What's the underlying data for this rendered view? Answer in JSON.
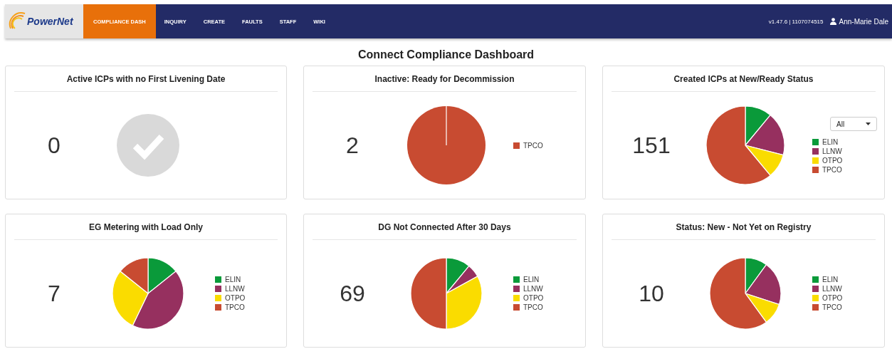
{
  "nav": {
    "logo": "PowerNet",
    "items": [
      {
        "label": "COMPLIANCE DASH",
        "selected": true
      },
      {
        "label": "INQUIRY",
        "selected": false
      },
      {
        "label": "CREATE",
        "selected": false
      },
      {
        "label": "FAULTS",
        "selected": false
      },
      {
        "label": "STAFF",
        "selected": false
      },
      {
        "label": "WIKI",
        "selected": false
      }
    ],
    "version": "v1.47.6 | 1107074515",
    "user": "Ann-Marie Dale"
  },
  "title": "Connect Compliance Dashboard",
  "cards": [
    {
      "title": "Active ICPs with no First Livening Date",
      "count": "0",
      "kind": "check"
    },
    {
      "title": "Inactive: Ready for Decommission",
      "count": "2",
      "kind": "pie",
      "legend": [
        {
          "label": "TPCO",
          "color": "#c84b31"
        }
      ]
    },
    {
      "title": "Created ICPs at New/Ready Status",
      "count": "151",
      "kind": "pie",
      "filter": "All",
      "legend": [
        {
          "label": "ELIN",
          "color": "#0a9a3a"
        },
        {
          "label": "LLNW",
          "color": "#96305f"
        },
        {
          "label": "OTPO",
          "color": "#fadc00"
        },
        {
          "label": "TPCO",
          "color": "#c84b31"
        }
      ]
    },
    {
      "title": "EG Metering with Load Only",
      "count": "7",
      "kind": "pie",
      "legend": [
        {
          "label": "ELIN",
          "color": "#0a9a3a"
        },
        {
          "label": "LLNW",
          "color": "#96305f"
        },
        {
          "label": "OTPO",
          "color": "#fadc00"
        },
        {
          "label": "TPCO",
          "color": "#c84b31"
        }
      ]
    },
    {
      "title": "DG Not Connected After 30 Days",
      "count": "69",
      "kind": "pie",
      "legend": [
        {
          "label": "ELIN",
          "color": "#0a9a3a"
        },
        {
          "label": "LLNW",
          "color": "#96305f"
        },
        {
          "label": "OTPO",
          "color": "#fadc00"
        },
        {
          "label": "TPCO",
          "color": "#c84b31"
        }
      ]
    },
    {
      "title": "Status: New - Not Yet on Registry",
      "count": "10",
      "kind": "pie",
      "legend": [
        {
          "label": "ELIN",
          "color": "#0a9a3a"
        },
        {
          "label": "LLNW",
          "color": "#96305f"
        },
        {
          "label": "OTPO",
          "color": "#fadc00"
        },
        {
          "label": "TPCO",
          "color": "#c84b31"
        }
      ]
    }
  ]
}
